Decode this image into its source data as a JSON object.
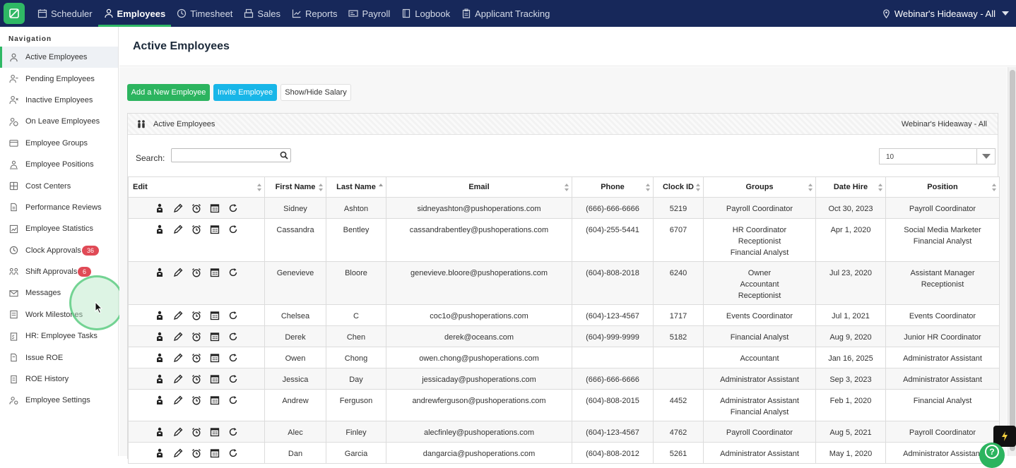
{
  "topbar": {
    "nav": [
      {
        "label": "Scheduler",
        "icon": "calendar-icon",
        "active": false
      },
      {
        "label": "Employees",
        "icon": "person-icon",
        "active": true
      },
      {
        "label": "Timesheet",
        "icon": "clock-icon",
        "active": false
      },
      {
        "label": "Sales",
        "icon": "register-icon",
        "active": false
      },
      {
        "label": "Reports",
        "icon": "chart-icon",
        "active": false
      },
      {
        "label": "Payroll",
        "icon": "payroll-icon",
        "active": false
      },
      {
        "label": "Logbook",
        "icon": "book-icon",
        "active": false
      },
      {
        "label": "Applicant Tracking",
        "icon": "clipboard-icon",
        "active": false
      }
    ],
    "location": "Webinar's Hideaway - All"
  },
  "sidebar": {
    "title": "Navigation",
    "items": [
      {
        "label": "Active Employees",
        "icon": "person-icon",
        "active": true
      },
      {
        "label": "Pending Employees",
        "icon": "person-minus-icon"
      },
      {
        "label": "Inactive Employees",
        "icon": "person-x-icon"
      },
      {
        "label": "On Leave Employees",
        "icon": "person-leave-icon"
      },
      {
        "label": "Employee Groups",
        "icon": "groups-icon"
      },
      {
        "label": "Employee Positions",
        "icon": "positions-icon"
      },
      {
        "label": "Cost Centers",
        "icon": "cost-center-icon"
      },
      {
        "label": "Performance Reviews",
        "icon": "document-icon"
      },
      {
        "label": "Employee Statistics",
        "icon": "stats-icon"
      },
      {
        "label": "Clock Approvals",
        "icon": "clock-icon",
        "badge": "36"
      },
      {
        "label": "Shift Approvals",
        "icon": "shift-icon",
        "badge": "6"
      },
      {
        "label": "Messages",
        "icon": "envelope-icon"
      },
      {
        "label": "Work Milestones",
        "icon": "milestone-icon"
      },
      {
        "label": "HR: Employee Tasks",
        "icon": "tasks-icon"
      },
      {
        "label": "Issue ROE",
        "icon": "roe-icon"
      },
      {
        "label": "ROE History",
        "icon": "history-icon"
      },
      {
        "label": "Employee Settings",
        "icon": "settings-person-icon"
      }
    ]
  },
  "page": {
    "title": "Active Employees",
    "buttons": {
      "add": "Add a New Employee",
      "invite": "Invite Employee",
      "salary": "Show/Hide Salary"
    },
    "panel_title": "Active Employees",
    "panel_location": "Webinar's Hideaway - All",
    "search_label": "Search:",
    "search_value": "",
    "per_page": "10"
  },
  "table": {
    "columns": [
      "Edit",
      "First Name",
      "Last Name",
      "Email",
      "Phone",
      "Clock ID",
      "Groups",
      "Date Hire",
      "Position"
    ],
    "rows": [
      {
        "first": "Sidney",
        "last": "Ashton",
        "email": "sidneyashton@pushoperations.com",
        "phone": "(666)-666-6666",
        "clock": "5219",
        "groups": [
          "Payroll Coordinator"
        ],
        "hire": "Oct 30, 2023",
        "position": [
          "Payroll Coordinator"
        ]
      },
      {
        "first": "Cassandra",
        "last": "Bentley",
        "email": "cassandrabentley@pushoperations.com",
        "phone": "(604)-255-5441",
        "clock": "6707",
        "groups": [
          "HR Coordinator",
          "Receptionist",
          "Financial Analyst"
        ],
        "hire": "Apr 1, 2020",
        "position": [
          "Social Media Marketer",
          "Financial Analyst"
        ]
      },
      {
        "first": "Genevieve",
        "last": "Bloore",
        "email": "genevieve.bloore@pushoperations.com",
        "phone": "(604)-808-2018",
        "clock": "6240",
        "groups": [
          "Owner",
          "Accountant",
          "Receptionist"
        ],
        "hire": "Jul 23, 2020",
        "position": [
          "Assistant Manager",
          "Receptionist"
        ]
      },
      {
        "first": "Chelsea",
        "last": "C",
        "email": "coc1o@pushoperations.com",
        "phone": "(604)-123-4567",
        "clock": "1717",
        "groups": [
          "Events Coordinator"
        ],
        "hire": "Jul 1, 2021",
        "position": [
          "Events Coordinator"
        ]
      },
      {
        "first": "Derek",
        "last": "Chen",
        "email": "derek@oceans.com",
        "phone": "(604)-999-9999",
        "clock": "5182",
        "groups": [
          "Financial Analyst"
        ],
        "hire": "Aug 9, 2020",
        "position": [
          "Junior HR Coordinator"
        ]
      },
      {
        "first": "Owen",
        "last": "Chong",
        "email": "owen.chong@pushoperations.com",
        "phone": "",
        "clock": "",
        "groups": [
          "Accountant"
        ],
        "hire": "Jan 16, 2025",
        "position": [
          "Administrator Assistant"
        ]
      },
      {
        "first": "Jessica",
        "last": "Day",
        "email": "jessicaday@pushoperations.com",
        "phone": "(666)-666-6666",
        "clock": "",
        "groups": [
          "Administrator Assistant"
        ],
        "hire": "Sep 3, 2023",
        "position": [
          "Administrator Assistant"
        ]
      },
      {
        "first": "Andrew",
        "last": "Ferguson",
        "email": "andrewferguson@pushoperations.com",
        "phone": "(604)-808-2015",
        "clock": "4452",
        "groups": [
          "Administrator Assistant",
          "Financial Analyst"
        ],
        "hire": "Feb 1, 2020",
        "position": [
          "Financial Analyst"
        ]
      },
      {
        "first": "Alec",
        "last": "Finley",
        "email": "alecfinley@pushoperations.com",
        "phone": "(604)-123-4567",
        "clock": "4762",
        "groups": [
          "Payroll Coordinator"
        ],
        "hire": "Aug 5, 2021",
        "position": [
          "Payroll Coordinator"
        ]
      },
      {
        "first": "Dan",
        "last": "Garcia",
        "email": "dangarcia@pushoperations.com",
        "phone": "(604)-808-2012",
        "clock": "5261",
        "groups": [
          "Administrator Assistant"
        ],
        "hire": "May 1, 2020",
        "position": [
          "Administrator Assistant"
        ]
      }
    ]
  },
  "colors": {
    "topbar": "#17285a",
    "accent": "#2cb45f",
    "invite": "#18b6e8",
    "badge": "#e04a56"
  }
}
